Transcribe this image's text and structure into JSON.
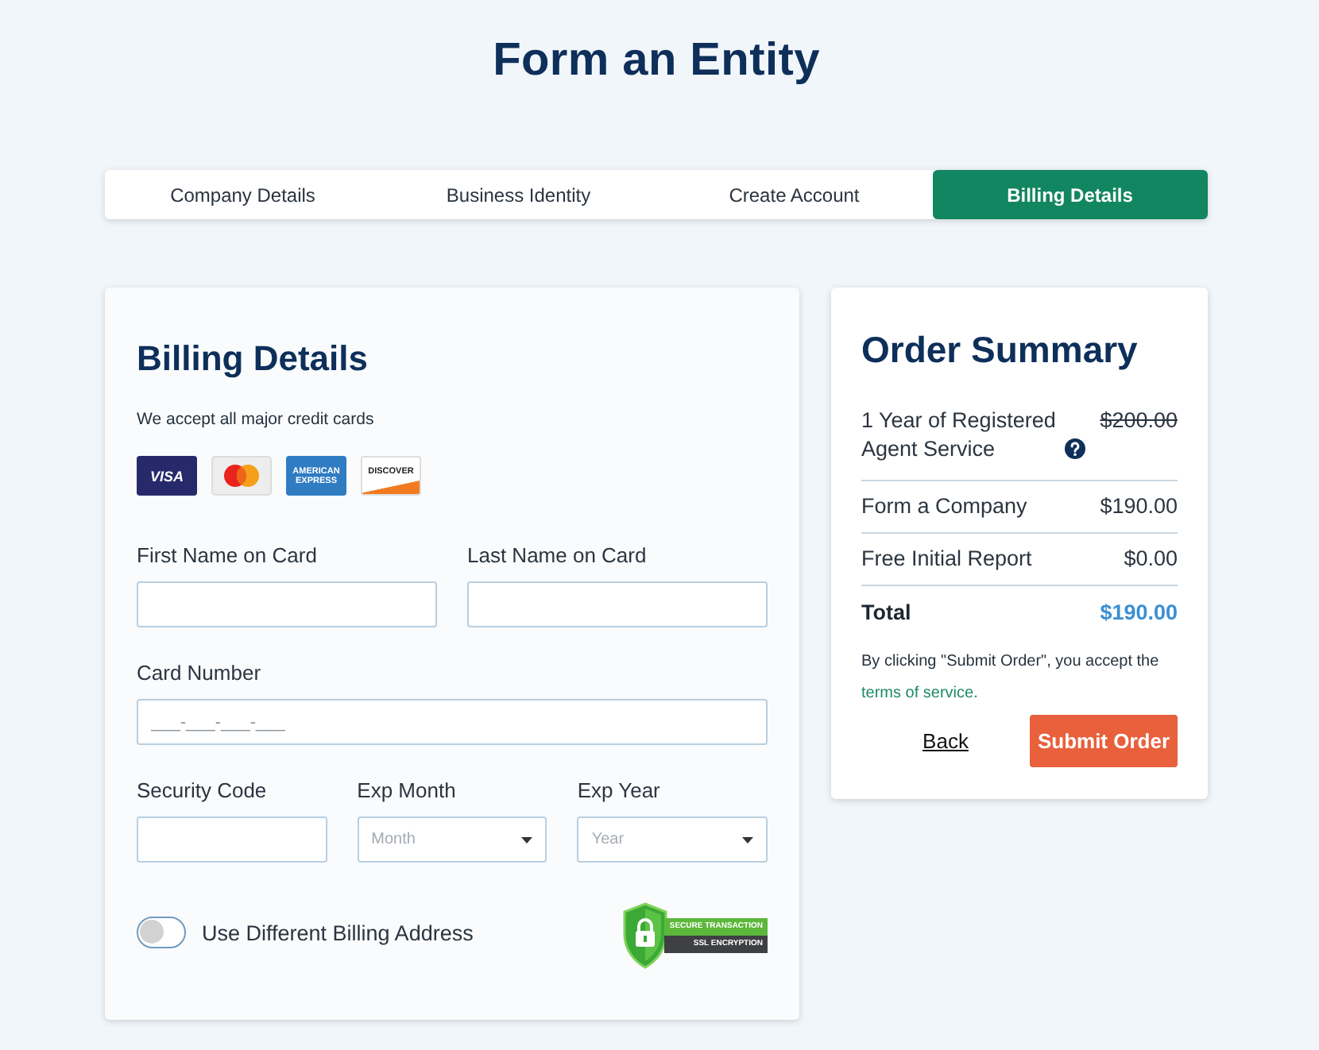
{
  "page": {
    "title": "Form an Entity"
  },
  "steps": [
    {
      "label": "Company Details",
      "selected": false
    },
    {
      "label": "Business Identity",
      "selected": false
    },
    {
      "label": "Create Account",
      "selected": false
    },
    {
      "label": "Billing Details",
      "selected": true
    }
  ],
  "billing": {
    "title": "Billing Details",
    "note": "We accept all major credit cards",
    "cards": [
      {
        "kind": "visa",
        "text": "VISA"
      },
      {
        "kind": "mastercard"
      },
      {
        "kind": "amex",
        "text": "AMERICAN EXPRESS"
      },
      {
        "kind": "discover",
        "text": "DISCOVER"
      }
    ],
    "rows": [
      {
        "fields": [
          {
            "label": "First Name on Card",
            "kind": "text"
          },
          {
            "label": "Last Name on Card",
            "kind": "text"
          }
        ]
      },
      {
        "fields": [
          {
            "label": "Card Number",
            "kind": "text",
            "placeholder": "___-___-___-___"
          }
        ]
      },
      {
        "fields": [
          {
            "label": "Security Code",
            "kind": "text"
          },
          {
            "label": "Exp Month",
            "kind": "select",
            "placeholder": "Month"
          },
          {
            "label": "Exp Year",
            "kind": "select",
            "placeholder": "Year"
          }
        ]
      }
    ],
    "toggle": {
      "label": "Use Different Billing Address",
      "on": false
    },
    "badge": {
      "lines": [
        "SECURE TRANSACTION",
        "SSL ENCRYPTION"
      ]
    }
  },
  "summary": {
    "title": "Order Summary",
    "items": [
      {
        "label": "1 Year of Registered Agent Service",
        "price": "$200.00",
        "struck": true,
        "info": true
      },
      {
        "label": "Form a Company",
        "price": "$190.00",
        "struck": false,
        "info": false
      },
      {
        "label": "Free Initial Report",
        "price": "$0.00",
        "struck": false,
        "info": false
      }
    ],
    "total": {
      "label": "Total",
      "price": "$190.00"
    },
    "terms": {
      "text": "By clicking \"Submit Order\", you accept the",
      "link": "terms of service."
    },
    "back": "Back",
    "submit": "Submit Order"
  }
}
